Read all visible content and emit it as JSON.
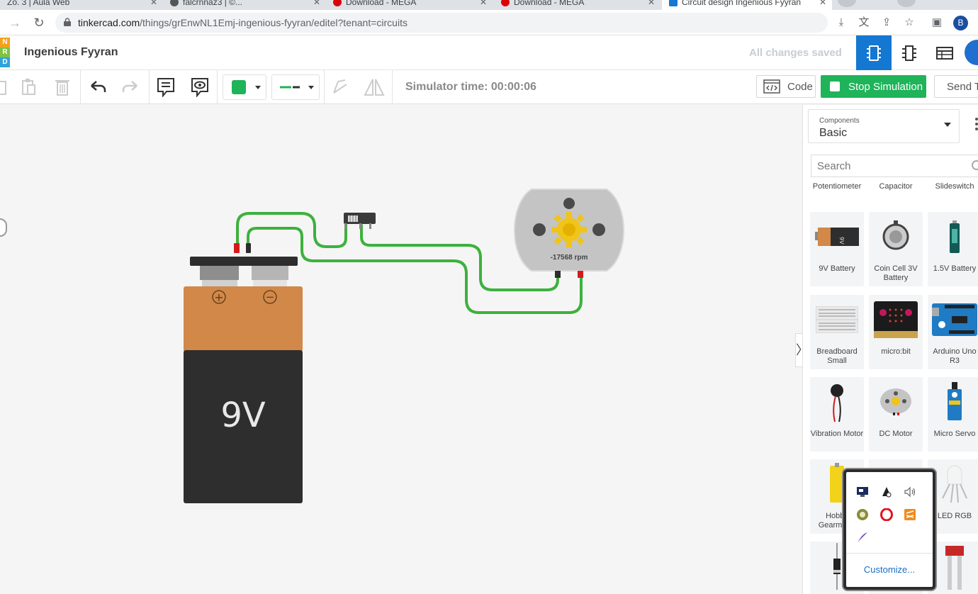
{
  "browser": {
    "tabs": [
      {
        "label": "Zo. 3 | Aula Web",
        "favicon_color": "#e2703a"
      },
      {
        "label": "falcrnnaz3 | ©..."
      },
      {
        "label": "Download - MEGA",
        "favicon_color": "#d90007"
      },
      {
        "label": "Download - MEGA",
        "favicon_color": "#d90007"
      },
      {
        "label": "Circuit design Ingenious Fyyran",
        "favicon_color": "#1477d1"
      }
    ],
    "url_host": "tinkercad.com",
    "url_path": "/things/grEnwNL1Emj-ingenious-fyyran/editel?tenant=circuits",
    "profile_initial": "B"
  },
  "app": {
    "logo_letters": [
      "N",
      "R",
      "D"
    ],
    "logo_colors": [
      "#f4a21b",
      "#7dc242",
      "#2fa3dc"
    ],
    "title": "Ingenious Fyyran",
    "save_status": "All changes saved",
    "accent": "#1477d1"
  },
  "toolbar": {
    "simulator_label": "Simulator time: 00:00:06",
    "code_label": "Code",
    "stop_label": "Stop Simulation",
    "send_label": "Send To",
    "color_swatch": "#1fb35a",
    "stop_color": "#1fb35a"
  },
  "canvas": {
    "battery_label": "9V",
    "battery_plus": "+",
    "battery_minus": "−",
    "motor_rpm": "-17568 rpm",
    "wire_color": "#3db13d"
  },
  "panel": {
    "components_label": "Components",
    "components_value": "Basic",
    "search_placeholder": "Search",
    "partial_row": [
      "Potentiometer",
      "Capacitor",
      "Slideswitch"
    ],
    "items": [
      {
        "name": "9V Battery"
      },
      {
        "name": "Coin Cell 3V Battery"
      },
      {
        "name": "1.5V Battery"
      },
      {
        "name": "Breadboard Small"
      },
      {
        "name": "micro:bit"
      },
      {
        "name": "Arduino Uno R3"
      },
      {
        "name": "Vibration Motor"
      },
      {
        "name": "DC Motor"
      },
      {
        "name": "Micro Servo"
      },
      {
        "name": "Hobby Gearmotor"
      },
      {
        "name": ""
      },
      {
        "name": "LED RGB"
      }
    ]
  },
  "tray_popup": {
    "customize_label": "Customize..."
  }
}
